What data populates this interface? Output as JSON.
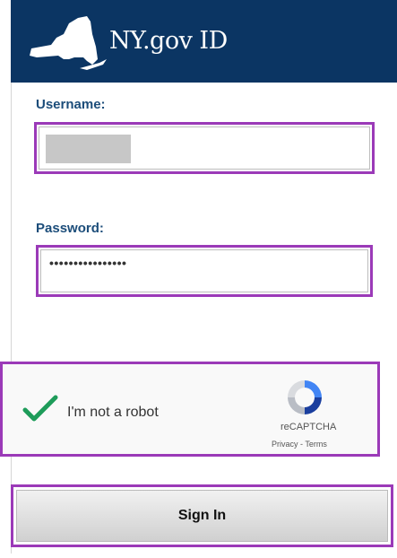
{
  "header": {
    "title": "NY.gov ID",
    "logo_icon": "new-york-state-icon",
    "background": "#0b3563"
  },
  "form": {
    "username_label": "Username:",
    "username_value_masked": true,
    "password_label": "Password:",
    "password_value": "••••••••••••••••",
    "focus_color": "#9b3ab8"
  },
  "captcha": {
    "checked": true,
    "label": "I'm not a robot",
    "brand": "reCAPTCHA",
    "links": "Privacy - Terms",
    "check_color": "#1e9c5a"
  },
  "signin": {
    "label": "Sign In"
  }
}
